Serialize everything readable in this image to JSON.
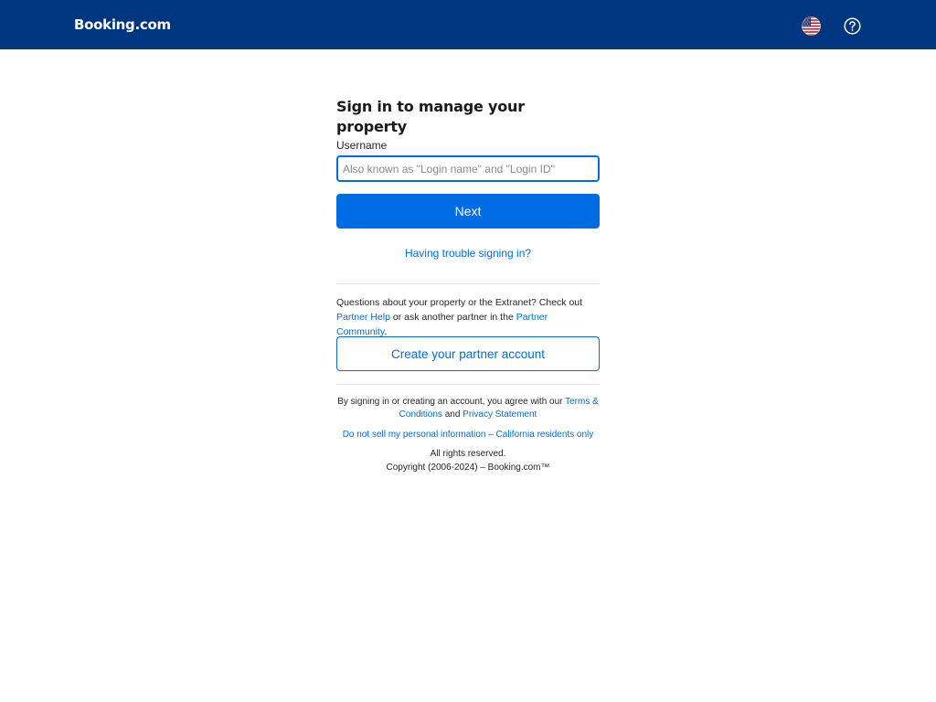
{
  "header": {
    "logo": "Booking.com",
    "language_icon": "us-flag-icon",
    "help_icon": "question-circle-icon",
    "bg_color": "#003580"
  },
  "form": {
    "title": "Sign in to manage your property",
    "username_label": "Username",
    "username_value": "",
    "username_placeholder": "Also known as \"Login name\" and \"Login ID\"",
    "next_label": "Next",
    "trouble_link": "Having trouble signing in?"
  },
  "help": {
    "text_1": "Questions about your property or the Extranet? Check out ",
    "partner_help_link": "Partner Help",
    "text_2": " or ask another partner in the ",
    "partner_community_link": "Partner Community",
    "text_3": "."
  },
  "create_account_label": "Create your partner account",
  "footer": {
    "legal_text_1": "By signing in or creating an account, you agree with our ",
    "terms_link": "Terms & Conditions",
    "legal_text_2": " and ",
    "privacy_link": "Privacy Statement",
    "ccpa_link": "Do not sell my personal information – California residents only",
    "rights": "All rights reserved.",
    "copyright": "Copyright (2006-2024) – Booking.com™"
  },
  "colors": {
    "brand_dark": "#003580",
    "accent": "#006ce4"
  }
}
